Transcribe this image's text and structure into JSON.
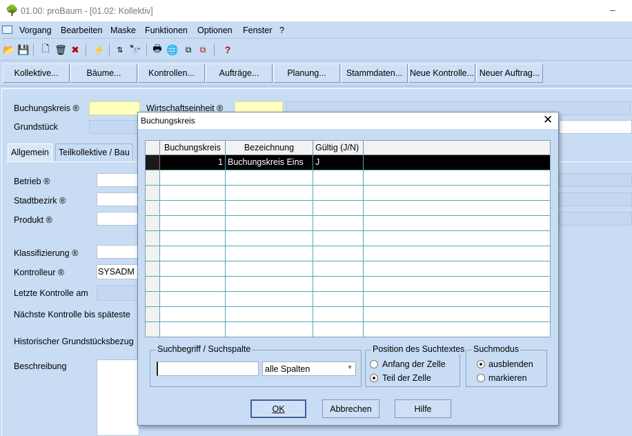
{
  "window": {
    "title": "01.00: proBaum - [01.02: Kollektiv]",
    "minimize_glyph": "–"
  },
  "menu": [
    "Vorgang",
    "Bearbeiten",
    "Maske",
    "Funktionen",
    "Optionen",
    "Fenster",
    "?"
  ],
  "nav_buttons": [
    "Kollektive...",
    "Bäume...",
    "Kontrollen...",
    "Aufträge...",
    "Planung...",
    "Stammdaten...",
    "Neue Kontrolle...",
    "Neuer Auftrag..."
  ],
  "form": {
    "buchungskreis_label": "Buchungskreis ®",
    "wirtschaftseinheit_label": "Wirtschaftseinheit ®",
    "grundstueck_label": "Grundstück",
    "tabs": [
      "Allgemein",
      "Teilkollektive / Bau"
    ],
    "betrieb_label": "Betrieb ®",
    "stadtbezirk_label": "Stadtbezirk ®",
    "produkt_label": "Produkt ®",
    "klassifizierung_label": "Klassifizierung ®",
    "kontrolleur_label": "Kontrolleur ®",
    "kontrolleur_value": "SYSADM",
    "letzte_kontrolle_label": "Letzte Kontrolle am",
    "naechste_kontrolle_label": "Nächste Kontrolle bis späteste",
    "historisch_label": "Historischer Grundstücksbezug",
    "beschreibung_label": "Beschreibung"
  },
  "dialog": {
    "title": "Buchungskreis",
    "close_glyph": "✕",
    "columns": [
      "Buchungskreis",
      "Bezeichnung",
      "Gültig (J/N)"
    ],
    "rows": [
      {
        "buchungskreis": "1",
        "bezeichnung": "Buchungskreis Eins",
        "gueltig": "J"
      }
    ],
    "search_group": "Suchbegriff / Suchspalte",
    "search_value": "",
    "column_select": "alle Spalten",
    "position_group": "Position des Suchtextes",
    "position_options": [
      "Anfang der Zelle",
      "Teil der Zelle"
    ],
    "mode_group": "Suchmodus",
    "mode_options": [
      "ausblenden",
      "markieren"
    ],
    "ok": "OK",
    "cancel": "Abbrechen",
    "help": "Hilfe"
  }
}
